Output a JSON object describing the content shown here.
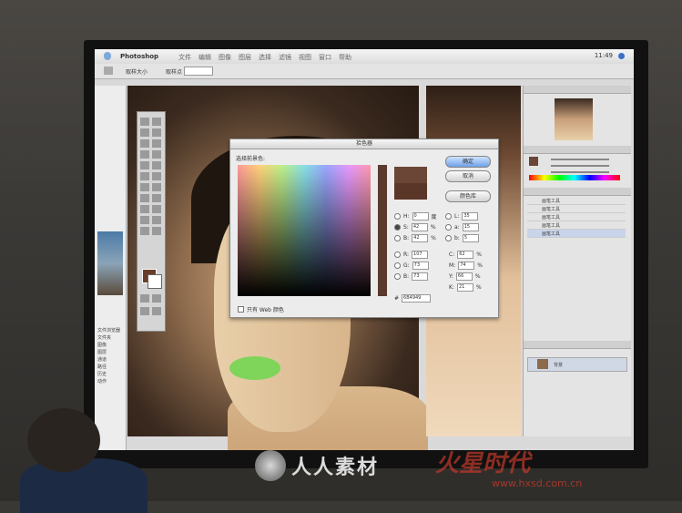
{
  "menubar": {
    "app_name": "Photoshop",
    "menus": [
      "文件",
      "编辑",
      "图像",
      "图层",
      "选择",
      "滤镜",
      "视图",
      "窗口",
      "帮助"
    ],
    "time": "11:49"
  },
  "options_bar": {
    "label1": "取样大小",
    "label2": "取样点"
  },
  "color_picker": {
    "title": "拾色器",
    "subtitle": "选择前景色:",
    "ok_button": "确定",
    "cancel_button": "取消",
    "libraries_button": "颜色库",
    "fields": [
      {
        "label": "H:",
        "value": "0",
        "unit": "度"
      },
      {
        "label": "S:",
        "value": "42",
        "unit": "%"
      },
      {
        "label": "B:",
        "value": "42",
        "unit": "%"
      },
      {
        "label": "R:",
        "value": "107",
        "unit": ""
      },
      {
        "label": "G:",
        "value": "73",
        "unit": ""
      },
      {
        "label": "B:",
        "value": "73",
        "unit": ""
      }
    ],
    "lab_fields": [
      {
        "label": "L:",
        "value": "35"
      },
      {
        "label": "a:",
        "value": "15"
      },
      {
        "label": "b:",
        "value": "5"
      }
    ],
    "cmyk_fields": [
      {
        "label": "C:",
        "value": "62",
        "unit": "%"
      },
      {
        "label": "M:",
        "value": "74",
        "unit": "%"
      },
      {
        "label": "Y:",
        "value": "66",
        "unit": "%"
      },
      {
        "label": "K:",
        "value": "21",
        "unit": "%"
      }
    ],
    "hex_value": "6B4949",
    "web_only_label": "只有 Web 颜色",
    "new_color": "#6b4636",
    "old_color": "#5a3628"
  },
  "history": {
    "items": [
      "画笔工具",
      "画笔工具",
      "画笔工具",
      "画笔工具",
      "画笔工具"
    ]
  },
  "layers": {
    "layer_name": "背景"
  },
  "left_panel": {
    "items": [
      "文件浏览器",
      "文件夹",
      "图像",
      "图层",
      "通道",
      "路径",
      "历史",
      "动作"
    ]
  },
  "watermark": {
    "text": "人人素材",
    "text2": "火星时代",
    "url": "www.hxsd.com.cn"
  }
}
